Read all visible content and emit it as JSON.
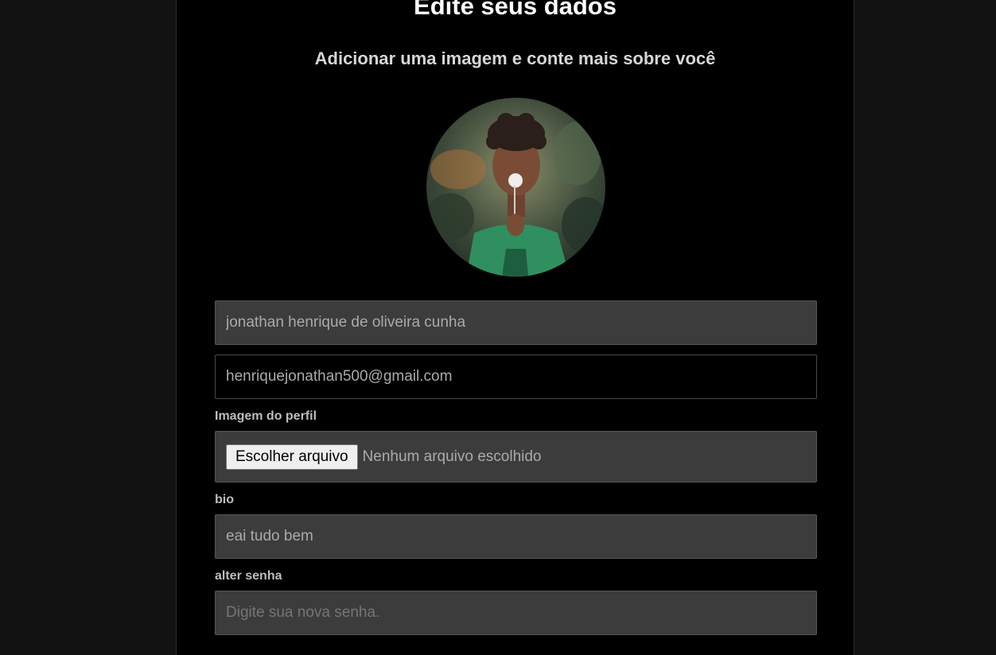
{
  "page": {
    "title": "Edite seus dados",
    "subtitle": "Adicionar uma imagem e conte mais sobre você"
  },
  "form": {
    "name_value": "jonathan henrique de oliveira cunha",
    "email_value": "henriquejonathan500@gmail.com",
    "image_label": "Imagem do perfil",
    "file_button_label": "Escolher arquivo",
    "file_status": "Nenhum arquivo escolhido",
    "bio_label": "bio",
    "bio_value": "eai tudo bem",
    "password_label": "alter senha",
    "password_placeholder": "Digite sua nova senha."
  },
  "colors": {
    "page_background": "#121212",
    "panel_background": "#000000",
    "input_background": "#3c3c3c"
  }
}
